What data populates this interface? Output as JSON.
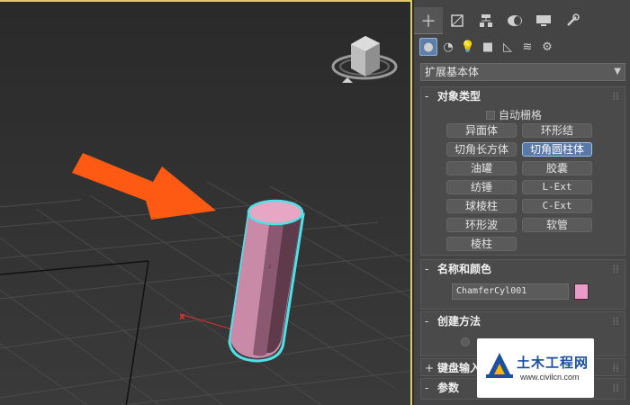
{
  "viewport": {
    "viewcube_icon": "viewcube-icon",
    "object_color": "#d89ab8",
    "selection_outline": "#4fe0e8",
    "arrow_color": "#ff5a14"
  },
  "command_panel": {
    "tabs": [
      "create-icon",
      "modify-icon",
      "hierarchy-icon",
      "motion-icon",
      "display-icon",
      "utilities-icon"
    ],
    "category_icons": [
      "geometry-icon",
      "shapes-icon",
      "lights-icon",
      "cameras-icon",
      "helpers-icon",
      "spacewarps-icon",
      "systems-icon"
    ],
    "dropdown_value": "扩展基本体",
    "object_type": {
      "title": "对象类型",
      "autogrid_label": "自动栅格",
      "buttons": [
        "异面体",
        "环形结",
        "切角长方体",
        "切角圆柱体",
        "油罐",
        "胶囊",
        "纺锤",
        "L-Ext",
        "球棱柱",
        "C-Ext",
        "环形波",
        "软管",
        "棱柱"
      ],
      "selected": "切角圆柱体"
    },
    "name_color": {
      "title": "名称和颜色",
      "name_value": "ChamferCyl001",
      "color": "#e99ac7"
    },
    "creation_method": {
      "title": "创建方法"
    },
    "keyboard_entry": {
      "title": "键盘输入"
    },
    "parameters": {
      "title": "参数"
    },
    "toggle_minus": "-",
    "toggle_plus": "+"
  },
  "watermark": {
    "title": "土木工程网",
    "url": "www.civilcn.com"
  }
}
